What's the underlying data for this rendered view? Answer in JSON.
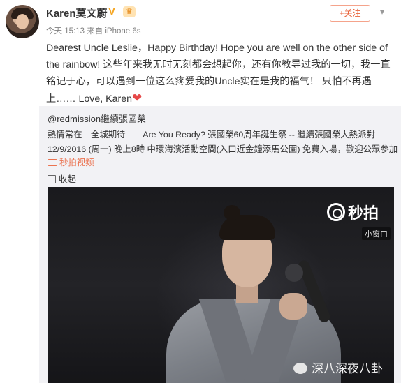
{
  "post": {
    "username": "Karen莫文蔚",
    "verified_icon": "verified-v-icon",
    "vip_icon": "vip-crown-icon",
    "meta": "今天 15:13 来自 iPhone 6s",
    "follow_label": "+关注",
    "menu_icon": "chevron-down-icon",
    "text_lines": [
      "Dearest Uncle Leslie，Happy Birthday! Hope you are well on the other side of",
      "the rainbow! 这些年来我无时无刻都会想起你，还有你教导过我的一切，我一直",
      "铭记于心，可以遇到一位这么疼爱我的Uncle实在是我的福气！  只怕不再遇",
      "上……  Love, Karen"
    ],
    "heart": "❤"
  },
  "repost": {
    "author": "@redmission繼續張國榮",
    "line1": "熱情常在　全城期待　　Are You Ready? 張國榮60周年誕生祭 -- 繼續張國榮大熱派對",
    "line2": "12/9/2016 (周一) 晚上8時 中環海濱活動空間(入口近金鐘添馬公園) 免費入場，歡迎公眾參加",
    "video_link": "秒拍视频",
    "favorite": "收起"
  },
  "video": {
    "brand": "秒拍",
    "mini_window": "小窗口",
    "watermark": "深八深夜八卦"
  },
  "colors": {
    "accent_orange": "#eb7350",
    "repost_bg": "#f2f2f5"
  }
}
